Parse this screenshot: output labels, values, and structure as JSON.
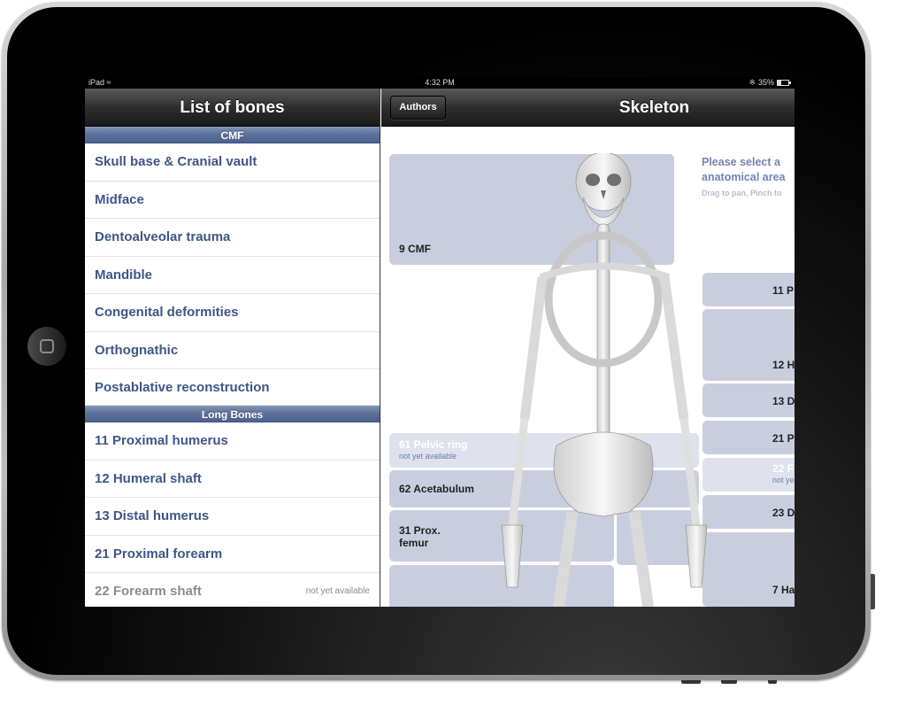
{
  "status_bar": {
    "device": "iPad",
    "time": "4:32 PM",
    "battery": "35%",
    "battery_level": 0.35
  },
  "master": {
    "title": "List of bones",
    "sections": [
      {
        "header": "CMF",
        "items": [
          {
            "label": "Skull base & Cranial vault",
            "available": true
          },
          {
            "label": "Midface",
            "available": true
          },
          {
            "label": "Dentoalveolar trauma",
            "available": true
          },
          {
            "label": "Mandible",
            "available": true
          },
          {
            "label": "Congenital deformities",
            "available": true
          },
          {
            "label": "Orthognathic",
            "available": true
          },
          {
            "label": "Postablative reconstruction",
            "available": true
          }
        ]
      },
      {
        "header": "Long Bones",
        "items": [
          {
            "label": "11 Proximal humerus",
            "available": true
          },
          {
            "label": "12 Humeral shaft",
            "available": true
          },
          {
            "label": "13 Distal humerus",
            "available": true
          },
          {
            "label": "21 Proximal forearm",
            "available": true
          },
          {
            "label": "22 Forearm shaft",
            "available": false,
            "badge": "not yet available"
          }
        ]
      }
    ]
  },
  "detail": {
    "title": "Skeleton",
    "authors_button": "Authors",
    "prompt_line1": "Please select a",
    "prompt_line2": "anatomical area",
    "hint": "Drag to pan, Pinch to",
    "regions": {
      "cmf": "9 CMF",
      "pelvic_ring": "61 Pelvic ring",
      "pelvic_ring_sub": "not yet available",
      "acetabulum": "62 Acetabulum",
      "prox_femur_1": "31 Prox.",
      "prox_femur_2": "femur",
      "r11": "11 P",
      "r12": "12 H",
      "r13": "13 D",
      "r21": "21 P",
      "r22": "22 F",
      "r22_sub": "not ye",
      "r23": "23 D",
      "r7": "7 Ha"
    }
  }
}
